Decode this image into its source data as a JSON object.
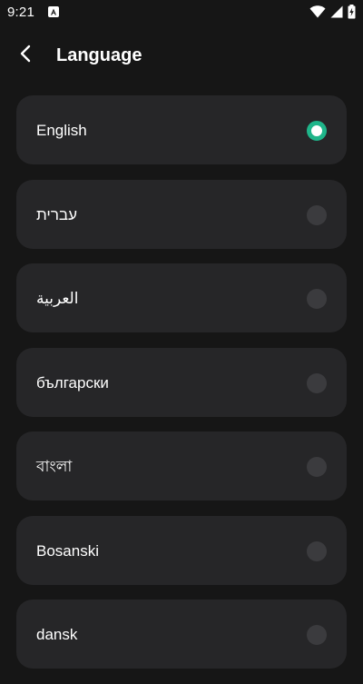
{
  "status_bar": {
    "time": "9:21",
    "icons": [
      "notification-a-icon",
      "wifi-icon",
      "cell-signal-icon",
      "battery-charging-icon"
    ]
  },
  "header": {
    "title": "Language",
    "back_icon": "chevron-left-icon"
  },
  "languages": [
    {
      "label": "English",
      "selected": true
    },
    {
      "label": "עברית",
      "selected": false
    },
    {
      "label": "العربية",
      "selected": false
    },
    {
      "label": "български",
      "selected": false
    },
    {
      "label": "বাংলা",
      "selected": false
    },
    {
      "label": "Bosanski",
      "selected": false
    },
    {
      "label": "dansk",
      "selected": false
    }
  ],
  "colors": {
    "background": "#161616",
    "card": "#262628",
    "accent": "#1fb58a",
    "radio_unselected": "#3b3b3e"
  }
}
